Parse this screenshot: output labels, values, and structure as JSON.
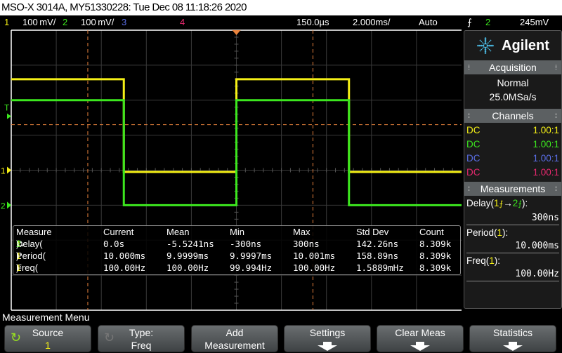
{
  "title": "MSO-X 3014A, MY51330228: Tue Dec 08 11:18:26 2020",
  "status": {
    "ch1_num": "1",
    "ch1_scale": "100 mV/",
    "ch2_num": "2",
    "ch2_scale": "100 mV/",
    "ch3_num": "3",
    "ch4_num": "4",
    "delay": "150.0µs",
    "timebase": "2.000ms/",
    "trigger_mode": "Auto",
    "trigger_source": "2",
    "trigger_level": "245mV"
  },
  "colors": {
    "ch1": "#f5f016",
    "ch2": "#3ce61e",
    "ch3": "#5a6ee6",
    "ch4": "#e6286e",
    "cursor": "#e8823c",
    "grid": "#3a3a3a"
  },
  "plot": {
    "trigger_marker": "T",
    "ch1_marker": "1",
    "ch2_marker": "2",
    "waveform": {
      "ch1_high_div": 2.6,
      "ch1_low_div": -0.05,
      "ch2_high_div": 2.0,
      "ch2_low_div": -1.0,
      "period_div": 5.0,
      "first_rising_div": 0.0,
      "duty": 0.5,
      "trigger_level_div": 1.3,
      "cursor_x_div": [
        -3.3,
        1.7
      ]
    }
  },
  "brand": {
    "name": "Agilent"
  },
  "acquisition": {
    "header": "Acquisition",
    "mode": "Normal",
    "rate": "25.0MSa/s"
  },
  "channels": {
    "header": "Channels",
    "rows": [
      {
        "coupling": "DC",
        "probe": "1.00:1"
      },
      {
        "coupling": "DC",
        "probe": "1.00:1"
      },
      {
        "coupling": "DC",
        "probe": "1.00:1"
      },
      {
        "coupling": "DC",
        "probe": "1.00:1"
      }
    ]
  },
  "measurements_panel": {
    "header": "Measurements",
    "items": [
      {
        "name_pre": "Delay(",
        "src1": "1",
        "arrow": "→",
        "src2": "2",
        "name_post": "):",
        "value": "300ns"
      },
      {
        "name_pre": "Period(",
        "src1": "1",
        "name_post": "):",
        "value": "10.000ms"
      },
      {
        "name_pre": "Freq(",
        "src1": "1",
        "name_post": "):",
        "value": "100.00Hz"
      }
    ]
  },
  "stats_table": {
    "headers": [
      "Measure",
      "Current",
      "Mean",
      "Min",
      "Max",
      "Std Dev",
      "Count"
    ],
    "rows": [
      {
        "measure_pre": "Delay(",
        "s1": "1",
        "arrow": "→",
        "s2": "2",
        "measure_post": "):",
        "values": [
          "0.0s",
          "-5.5241ns",
          "-300ns",
          "300ns",
          "142.26ns",
          "8.309k"
        ]
      },
      {
        "measure_pre": "Period(",
        "s1": "1",
        "measure_post": "):",
        "values": [
          "10.000ms",
          "9.9999ms",
          "9.9997ms",
          "10.001ms",
          "158.89ns",
          "8.309k"
        ]
      },
      {
        "measure_pre": "Freq(",
        "s1": "1",
        "measure_post": "):",
        "values": [
          "100.00Hz",
          "100.00Hz",
          "99.994Hz",
          "100.00Hz",
          "1.5889mHz",
          "8.309k"
        ]
      }
    ]
  },
  "menu": {
    "title": "Measurement Menu",
    "softkeys": [
      {
        "line1": "Source",
        "line2": "1",
        "icon": "cycle-active"
      },
      {
        "line1": "Type:",
        "line2": "Freq",
        "icon": "cycle-inactive"
      },
      {
        "line1": "Add",
        "line2": "Measurement"
      },
      {
        "line1": "Settings",
        "icon": "down-arrow"
      },
      {
        "line1": "Clear Meas",
        "icon": "down-arrow"
      },
      {
        "line1": "Statistics",
        "icon": "down-arrow"
      }
    ]
  }
}
